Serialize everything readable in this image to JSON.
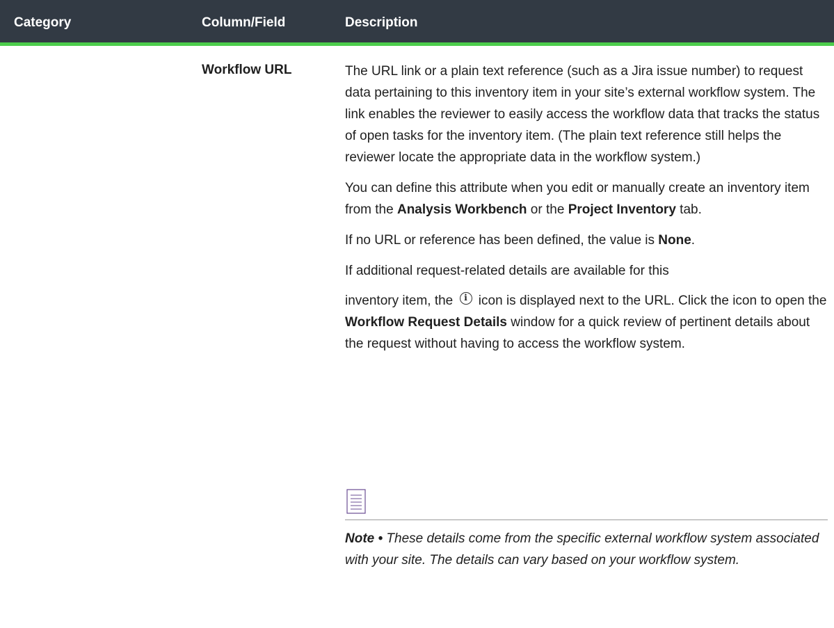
{
  "table": {
    "headers": {
      "category": "Category",
      "column_field": "Column/Field",
      "description": "Description"
    },
    "row": {
      "field_name": "Workflow URL",
      "p1": "The URL link or a plain text reference (such as a Jira issue number) to request data pertaining to this inventory item in your site’s external workflow system. The link enables the reviewer to easily access the workflow data that tracks the status of open tasks for the inventory item. (The plain text reference still helps the reviewer locate the appropriate data in the workflow system.)",
      "p2": {
        "before": "You can define this attribute when you edit or manually create an inventory item from the ",
        "bold1": "Analysis Workbench",
        "middle": " or the ",
        "bold2": "Project Inventory",
        "after": " tab."
      },
      "p3": {
        "before": "If no URL or reference has been defined, the value is ",
        "bold": "None",
        "after": "."
      },
      "p4": {
        "line1": "If additional request-related details are available for this",
        "before_icon": "inventory item, the ",
        "icon_glyph": "i",
        "after_icon": " icon is displayed next to the URL. Click the icon to open the ",
        "bold": "Workflow Request Details",
        "after": " window for a quick review of pertinent details about the request without having to access the workflow system."
      },
      "note": {
        "label": "Note •",
        "text": " These details come from the specific external workflow system associated with your site. The details can vary based on your workflow system."
      }
    }
  },
  "icons": {
    "info": "info-circle-icon",
    "note": "note-document-icon"
  },
  "colors": {
    "header_bg": "#323a44",
    "header_accent": "#4ccd4c",
    "note_icon": "#6a4c93"
  }
}
